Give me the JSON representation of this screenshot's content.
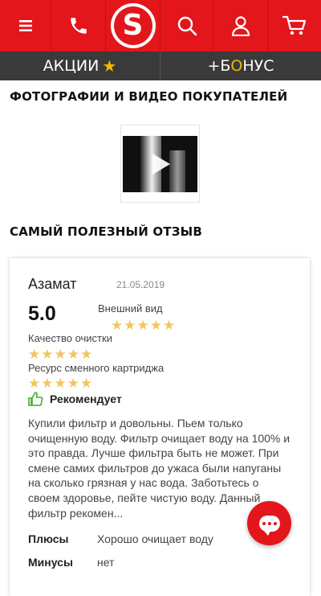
{
  "header": {
    "menu_icon": "hamburger-icon",
    "phone_icon": "phone-icon",
    "logo_letter": "S",
    "search_icon": "search-icon",
    "user_icon": "user-icon",
    "cart_icon": "cart-icon",
    "brand_color": "#e3161b"
  },
  "promo": {
    "actions_label": "АКЦИИ",
    "bonus_plus": "+Б",
    "bonus_o": "О",
    "bonus_rest": "НУС",
    "accent_color": "#f2b800"
  },
  "media": {
    "title": "ФОТОГРАФИИ И ВИДЕО ПОКУПАТЕЛЕЙ"
  },
  "review_section": {
    "title": "САМЫЙ ПОЛЕЗНЫЙ ОТЗЫВ"
  },
  "review": {
    "author": "Азамат",
    "date": "21.05.2019",
    "score": "5.0",
    "criteria": [
      {
        "label": "Внешний вид",
        "stars": "★★★★★"
      },
      {
        "label": "Качество очистки",
        "stars": "★★★★★"
      },
      {
        "label": "Ресурс сменного картриджа",
        "stars": "★★★★★"
      }
    ],
    "recommend_label": "Рекомендует",
    "text": "Купили фильтр и довольны. Пьем только очищенную воду. Фильтр очищает воду на 100% и это правда. Лучше фильтра быть не может. При смене самих фильтров до ужаса были напуганы на сколько грязная у нас вода. Заботьтесь о своем здоровье, пейте чистую воду. Данный фильтр рекомен...",
    "pros_label": "Плюсы",
    "pros_value": "Хорошо очищает воду",
    "cons_label": "Минусы",
    "cons_value": "нет"
  },
  "chat": {
    "icon": "chat-icon"
  }
}
